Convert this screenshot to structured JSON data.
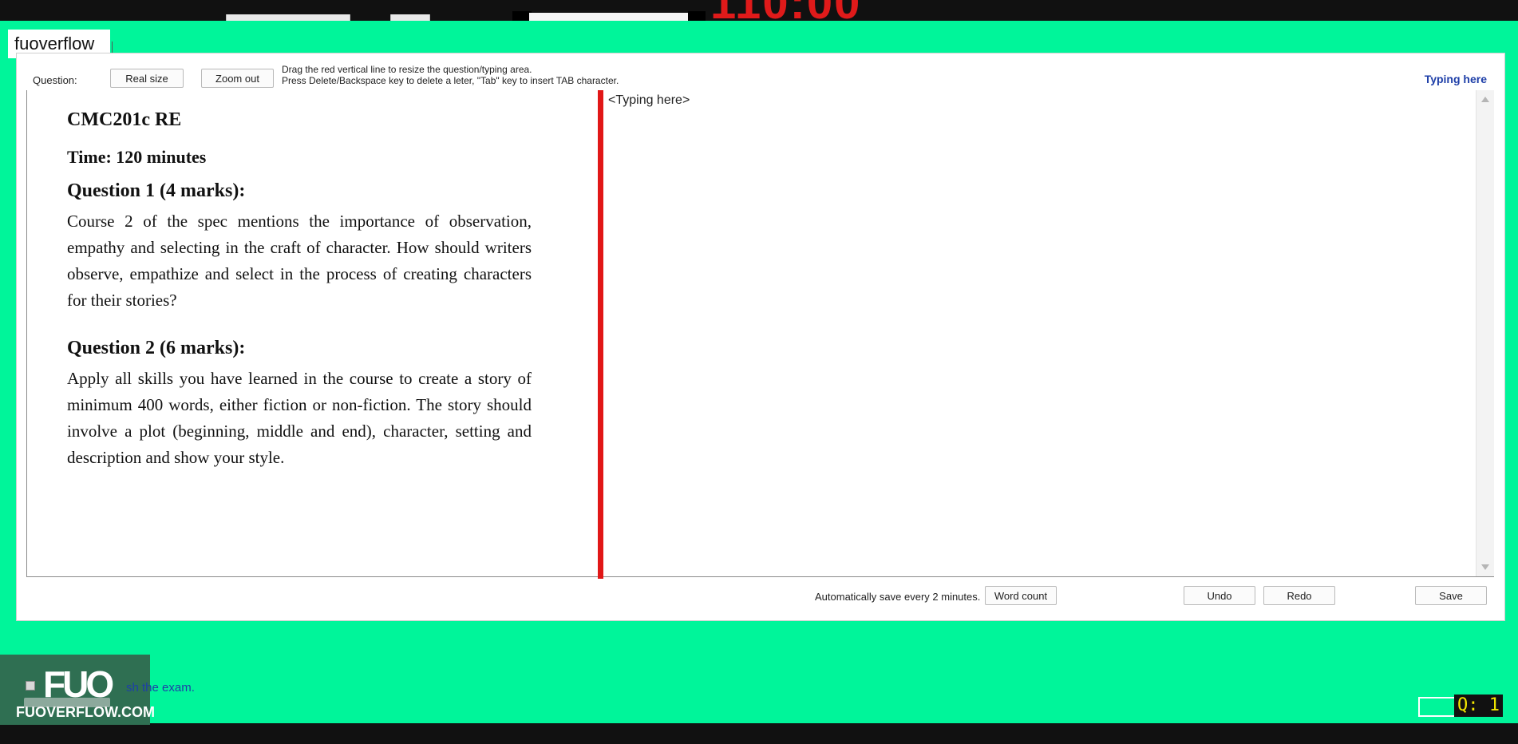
{
  "window": {
    "timer": "110:00"
  },
  "brand": {
    "tag_text": "fuoverflow",
    "logo_mark": "FUO",
    "logo_url": "FUOVERFLOW.COM"
  },
  "toolbar": {
    "question_label": "Question:",
    "real_size_label": "Real size",
    "zoom_out_label": "Zoom out",
    "hint_line1": "Drag the red vertical line to resize the question/typing area.",
    "hint_line2": "Press Delete/Backspace key to delete a leter, \"Tab\" key to insert TAB character.",
    "typing_here_link": "Typing here"
  },
  "question": {
    "title": "CMC201c RE",
    "time": "Time: 120 minutes",
    "q1_heading": "Question 1 (4 marks):",
    "q1_body": "Course 2 of the spec mentions the importance of observation, empathy and selecting in the craft of character. How should writers observe, empathize and select in the process of creating characters for their stories?",
    "q2_heading": "Question 2 (6 marks):",
    "q2_body": "Apply all skills you have learned in the course to create a story of minimum 400 words, either fiction or non-fiction. The story should involve a plot (beginning, middle and end), character, setting and description and show your style."
  },
  "editor": {
    "placeholder": "<Typing here>"
  },
  "footer": {
    "autosave_text": "Automatically save every 2 minutes.",
    "word_count_label": "Word count",
    "undo_label": "Undo",
    "redo_label": "Redo",
    "save_label": "Save",
    "finish_text": "sh the exam.",
    "question_indicator": "Q: 1"
  },
  "colors": {
    "background": "#00F59A",
    "splitter": "#E11717",
    "link": "#1E3FA8",
    "timer": "#E01A1A",
    "indicator_text": "#F2E600"
  }
}
